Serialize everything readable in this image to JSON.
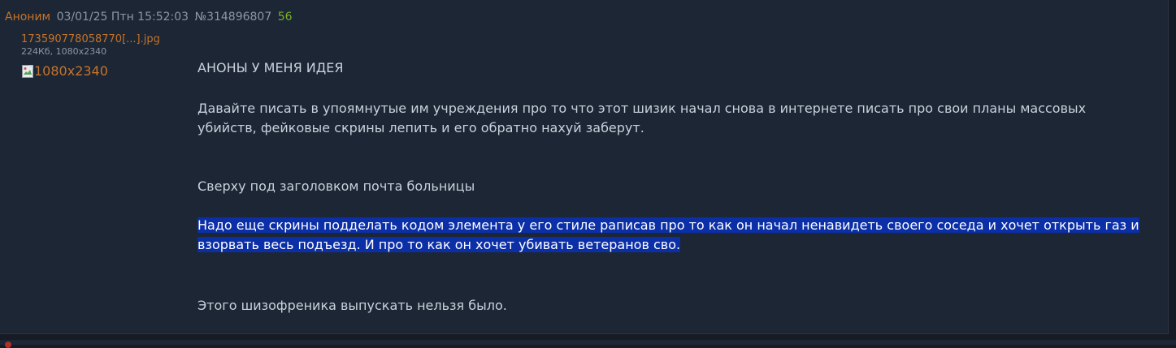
{
  "post": {
    "author": "Аноним",
    "datetime": "03/01/25 Птн 15:52:03",
    "number": "№314896807",
    "replies": "56",
    "file": {
      "name": "173590778058770[...].jpg",
      "meta": "224Кб, 1080x2340",
      "thumb_alt": "1080x2340"
    },
    "body": {
      "p1": "АНОНЫ У МЕНЯ ИДЕЯ",
      "p2": "Давайте писать в упоямнутые им учреждения про то что этот шизик начал снова в интернете писать про свои планы массовых убийств, фейковые скрины лепить и его обратно нахуй заберут.",
      "p3": "Сверху под заголовком почта больницы",
      "p4": "Надо еще скрины подделать кодом элемента у его стиле раписав про то как он начал ненавидеть своего соседа и хочет открыть газ и взорвать весь подъезд. И про то как он хочет убивать ветеранов сво.",
      "p5": "Этого шизофреника выпускать нельзя было."
    }
  },
  "colors": {
    "background": "#171c24",
    "post_background": "#1c2634",
    "author": "#c5742a",
    "meta": "#8b97a8",
    "replies": "#7eae2e",
    "text": "#c9d1dc",
    "selection": "#0b2fa6"
  },
  "icons": {
    "thumbnail": "broken-image-icon"
  }
}
